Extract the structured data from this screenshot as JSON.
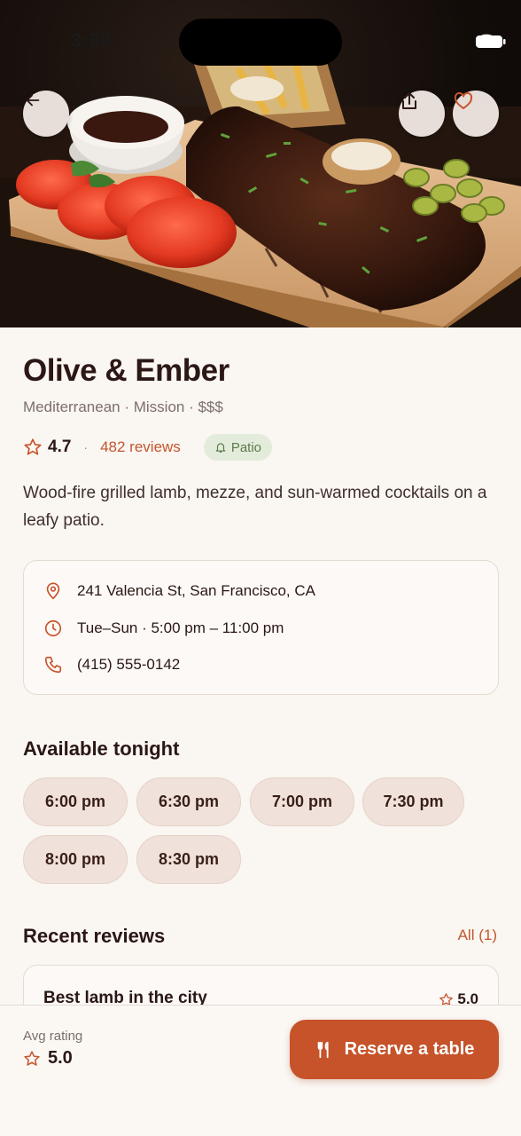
{
  "status_bar": {
    "time": "3:59"
  },
  "restaurant": {
    "name": "Olive & Ember",
    "meta": "Mediterranean · Mission · $$$",
    "rating": "4.7",
    "separator": "·",
    "reviews_link": "482 reviews",
    "badge": "Patio",
    "description": "Wood-fire grilled lamb, mezze, and sun-warmed cocktails on a leafy patio."
  },
  "info": {
    "address": "241 Valencia St, San Francisco, CA",
    "hours": "Tue–Sun · 5:00 pm – 11:00 pm",
    "phone": "(415) 555-0142"
  },
  "availability": {
    "title": "Available tonight",
    "slots": [
      "6:00 pm",
      "6:30 pm",
      "7:00 pm",
      "7:30 pm",
      "8:00 pm",
      "8:30 pm"
    ]
  },
  "reviews": {
    "title": "Recent reviews",
    "all_link": "All (1)",
    "items": [
      {
        "title": "Best lamb in the city",
        "score": "5.0"
      }
    ]
  },
  "footer": {
    "avg_label": "Avg rating",
    "avg_value": "5.0",
    "reserve_label": "Reserve a table"
  },
  "icons": {
    "back": "arrow-left-icon",
    "share": "share-icon",
    "favorite": "heart-icon",
    "rating": "star-icon",
    "patio": "bell-icon",
    "address": "map-pin-icon",
    "hours": "clock-icon",
    "phone": "phone-icon",
    "reserve": "utensils-icon"
  },
  "colors": {
    "accent": "#c6532a",
    "link": "#c2562f",
    "badge_bg": "#e3ecdb",
    "badge_text": "#5d7a4c",
    "background": "#faf6f1"
  }
}
